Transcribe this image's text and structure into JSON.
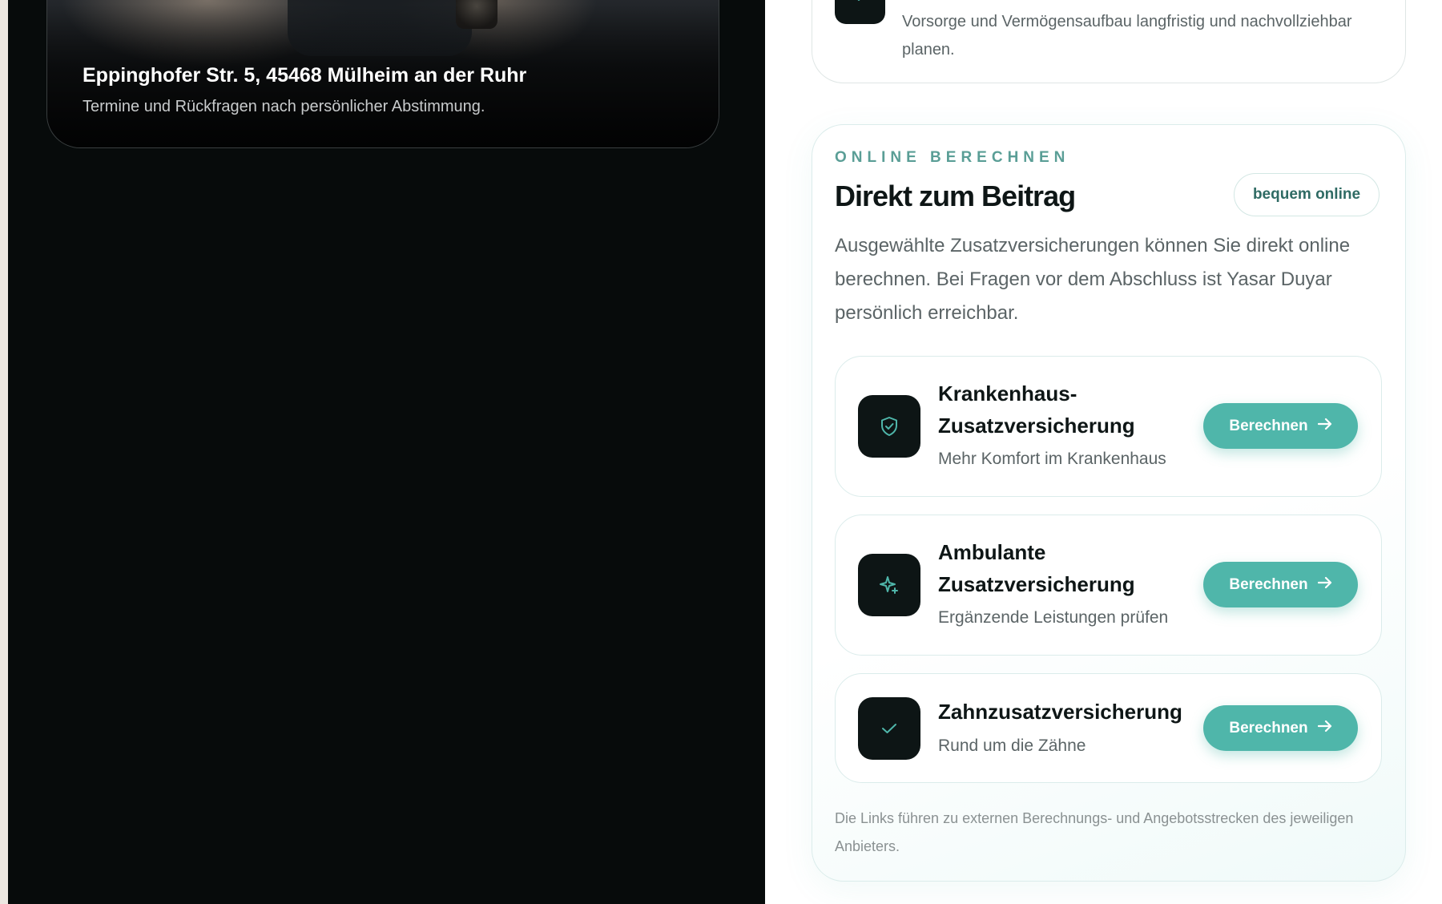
{
  "left": {
    "address": "Eppinghofer Str. 5, 45468 Mülheim an der Ruhr",
    "note": "Termine und Rückfragen nach persönlicher Abstimmung."
  },
  "top_card": {
    "text": "Vorsorge und Vermögensaufbau langfristig und nachvollziehbar planen.",
    "icon": "check-icon"
  },
  "online": {
    "eyebrow": "ONLINE BERECHNEN",
    "title": "Direkt zum Beitrag",
    "badge": "bequem online",
    "intro": "Ausgewählte Zusatzversicherungen können Sie direkt online berechnen. Bei Fragen vor dem Abschluss ist Yasar Duyar persönlich erreichbar.",
    "products": [
      {
        "title": "Krankenhaus-Zusatzversicherung",
        "subtitle": "Mehr Komfort im Krankenhaus",
        "button": "Berechnen",
        "icon": "shield-check-icon"
      },
      {
        "title": "Ambulante Zusatzversicherung",
        "subtitle": "Ergänzende Leistungen prüfen",
        "button": "Berechnen",
        "icon": "sparkle-icon"
      },
      {
        "title": "Zahnzusatzversicherung",
        "subtitle": "Rund um die Zähne",
        "button": "Berechnen",
        "icon": "check-icon"
      }
    ],
    "footnote": "Die Links führen zu externen Berechnungs- und Angebotsstrecken des jeweiligen Anbieters."
  },
  "colors": {
    "accent": "#4fb6aa",
    "dark": "#070b0b",
    "icon_bg": "#0d1515",
    "eyebrow": "#5a9e96"
  }
}
